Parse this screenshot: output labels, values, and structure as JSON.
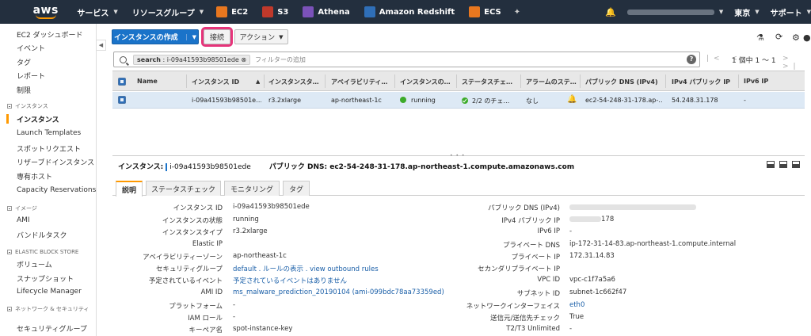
{
  "topnav": {
    "logo": "aws",
    "services": "サービス",
    "resource_groups": "リソースグループ",
    "shortcuts": [
      {
        "label": "EC2",
        "color": "#e8771f"
      },
      {
        "label": "S3",
        "color": "#c0392b"
      },
      {
        "label": "Athena",
        "color": "#7b52b9"
      },
      {
        "label": "Amazon Redshift",
        "color": "#2f6fb8"
      },
      {
        "label": "ECS",
        "color": "#e8771f"
      }
    ],
    "region": "東京",
    "support": "サポート"
  },
  "sidebar": {
    "items": [
      {
        "label": "EC2 ダッシュボード"
      },
      {
        "label": "イベント"
      },
      {
        "label": "タグ"
      },
      {
        "label": "レポート"
      },
      {
        "label": "制限"
      }
    ],
    "sections": [
      {
        "title": "インスタンス",
        "items": [
          "インスタンス",
          "Launch Templates",
          "スポットリクエスト",
          "リザーブドインスタンス",
          "専有ホスト",
          "Capacity Reservations"
        ]
      },
      {
        "title": "イメージ",
        "items": [
          "AMI",
          "バンドルタスク"
        ]
      },
      {
        "title": "ELASTIC BLOCK STORE",
        "items": [
          "ボリューム",
          "スナップショット",
          "Lifecycle Manager"
        ]
      },
      {
        "title": "ネットワーク & セキュリティ",
        "items": [
          "セキュリティグループ"
        ]
      }
    ],
    "active": "インスタンス"
  },
  "toolbar": {
    "launch": "インスタンスの作成",
    "connect": "接続",
    "actions": "アクション"
  },
  "search": {
    "token_key": "search",
    "token_value": "i-09a41593b98501ede",
    "placeholder": "フィルターの追加"
  },
  "pager": {
    "text": "1 個中 1 〜 1"
  },
  "table": {
    "columns": [
      "Name",
      "インスタンス ID",
      "インスタンスタ…",
      "アベイラビリティ…",
      "インスタンスの…",
      "ステータスチェ…",
      "アラームのステ…",
      "パブリック DNS (IPv4)",
      "IPv4 パブリック IP",
      "IPv6 IP"
    ],
    "row": {
      "name": "",
      "instance_id": "i-09a41593b98501e…",
      "type": "r3.2xlarge",
      "az": "ap-northeast-1c",
      "state": "running",
      "status": "2/2 のチェ…",
      "alarm": "なし",
      "dns": "ec2-54-248-31-178.ap-…",
      "ipv4": "54.248.31.178",
      "ipv6": "-"
    }
  },
  "detail": {
    "instance_label": "インスタンス:",
    "instance_id": "i-09a41593b98501ede",
    "dns_label": "パブリック DNS:",
    "dns_value": "ec2-54-248-31-178.ap-northeast-1.compute.amazonaws.com",
    "tabs": [
      "説明",
      "ステータスチェック",
      "モニタリング",
      "タグ"
    ],
    "left": [
      {
        "label": "インスタンス ID",
        "value": "i-09a41593b98501ede"
      },
      {
        "label": "インスタンスの状態",
        "value": "running"
      },
      {
        "label": "インスタンスタイプ",
        "value": "r3.2xlarge"
      },
      {
        "label": "Elastic IP",
        "value": ""
      },
      {
        "label": "アベイラビリティーゾーン",
        "value": "ap-northeast-1c"
      },
      {
        "label": "セキュリティグループ",
        "value": "default . ルールの表示 . view outbound rules",
        "link": true
      },
      {
        "label": "予定されているイベント",
        "value": "予定されているイベントはありません",
        "link": true
      },
      {
        "label": "AMI ID",
        "value": "ms_malware_prediction_20190104 (ami-099bdc78aa73359ed)",
        "link": true
      },
      {
        "label": "プラットフォーム",
        "value": "-"
      },
      {
        "label": "IAM ロール",
        "value": "-"
      },
      {
        "label": "キーペア名",
        "value": "spot-instance-key"
      }
    ],
    "right": [
      {
        "label": "パブリック DNS (IPv4)",
        "value": ""
      },
      {
        "label": "IPv4 パブリック IP",
        "value": "178"
      },
      {
        "label": "IPv6 IP",
        "value": "-"
      },
      {
        "label": "プライベート DNS",
        "value": "ip-172-31-14-83.ap-northeast-1.compute.internal"
      },
      {
        "label": "プライベート IP",
        "value": "172.31.14.83"
      },
      {
        "label": "セカンダリプライベート IP",
        "value": ""
      },
      {
        "label": "VPC ID",
        "value": "vpc-c1f7a5a6"
      },
      {
        "label": "サブネット ID",
        "value": "subnet-1c662f47"
      },
      {
        "label": "ネットワークインターフェイス",
        "value": "eth0",
        "link": true
      },
      {
        "label": "送信元/送信先チェック",
        "value": "True"
      },
      {
        "label": "T2/T3 Unlimited",
        "value": "-"
      }
    ]
  },
  "colors": {
    "nav_bg": "#232f3e",
    "accent": "#ff9900",
    "primary": "#1a73c9",
    "highlight": "#e6347a"
  }
}
